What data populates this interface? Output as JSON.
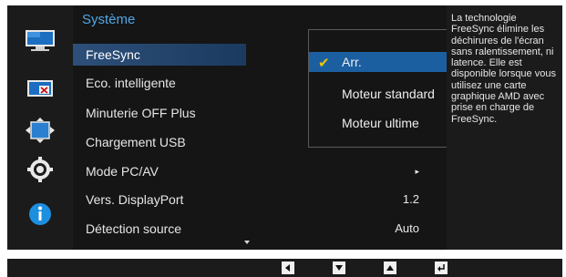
{
  "menu": {
    "title": "Système",
    "items": [
      {
        "label": "FreeSync",
        "value": ""
      },
      {
        "label": "Eco. intelligente",
        "value": ""
      },
      {
        "label": "Minuterie OFF Plus",
        "value": ""
      },
      {
        "label": "Chargement USB",
        "value": ""
      },
      {
        "label": "Mode PC/AV",
        "value": "▸"
      },
      {
        "label": "Vers. DisplayPort",
        "value": "1.2"
      },
      {
        "label": "Détection source",
        "value": "Auto"
      }
    ]
  },
  "submenu": {
    "options": [
      {
        "label": "Arr.",
        "selected": true
      },
      {
        "label": "Moteur standard",
        "selected": false
      },
      {
        "label": "Moteur ultime",
        "selected": false
      }
    ],
    "check_glyph": "✔"
  },
  "description": "La technologie FreeSync élimine les déchirures de l'écran sans ralentissement, ni latence. Elle est disponible lorsque vous utilisez une carte graphique AMD avec prise en charge de FreeSync.",
  "sidebar_icons": [
    "picture-icon",
    "pip-icon",
    "onscreen-display-icon",
    "system-gear-icon",
    "information-icon"
  ],
  "bottom_buttons": [
    "left-arrow-icon",
    "down-arrow-icon",
    "up-arrow-icon",
    "enter-icon"
  ],
  "colors": {
    "title_accent": "#4fa7e6",
    "selection_blue": "#1c5fa0",
    "check_yellow": "#f2c200",
    "info_blue": "#1d8fe0"
  }
}
